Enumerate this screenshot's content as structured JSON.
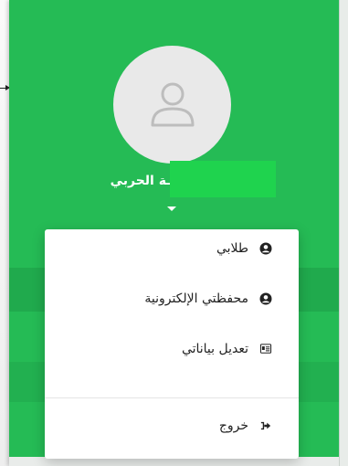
{
  "profile": {
    "name_visible": "ـة الحربي"
  },
  "menu": {
    "items": [
      {
        "label": "طلابي",
        "icon": "user-circle-icon"
      },
      {
        "label": "محفظتي الإلكترونية",
        "icon": "user-circle-icon"
      },
      {
        "label": "تعديل بياناتي",
        "icon": "id-card-icon"
      }
    ],
    "logout": {
      "label": "خروج",
      "icon": "sign-out-icon"
    }
  },
  "colors": {
    "sidebar_green": "#25bb55",
    "name_mask_green": "#1fd34e",
    "avatar_bg": "#e9e9e9",
    "avatar_icon": "#bdbdbd",
    "menu_bg": "#ffffff",
    "menu_text": "#222222"
  }
}
